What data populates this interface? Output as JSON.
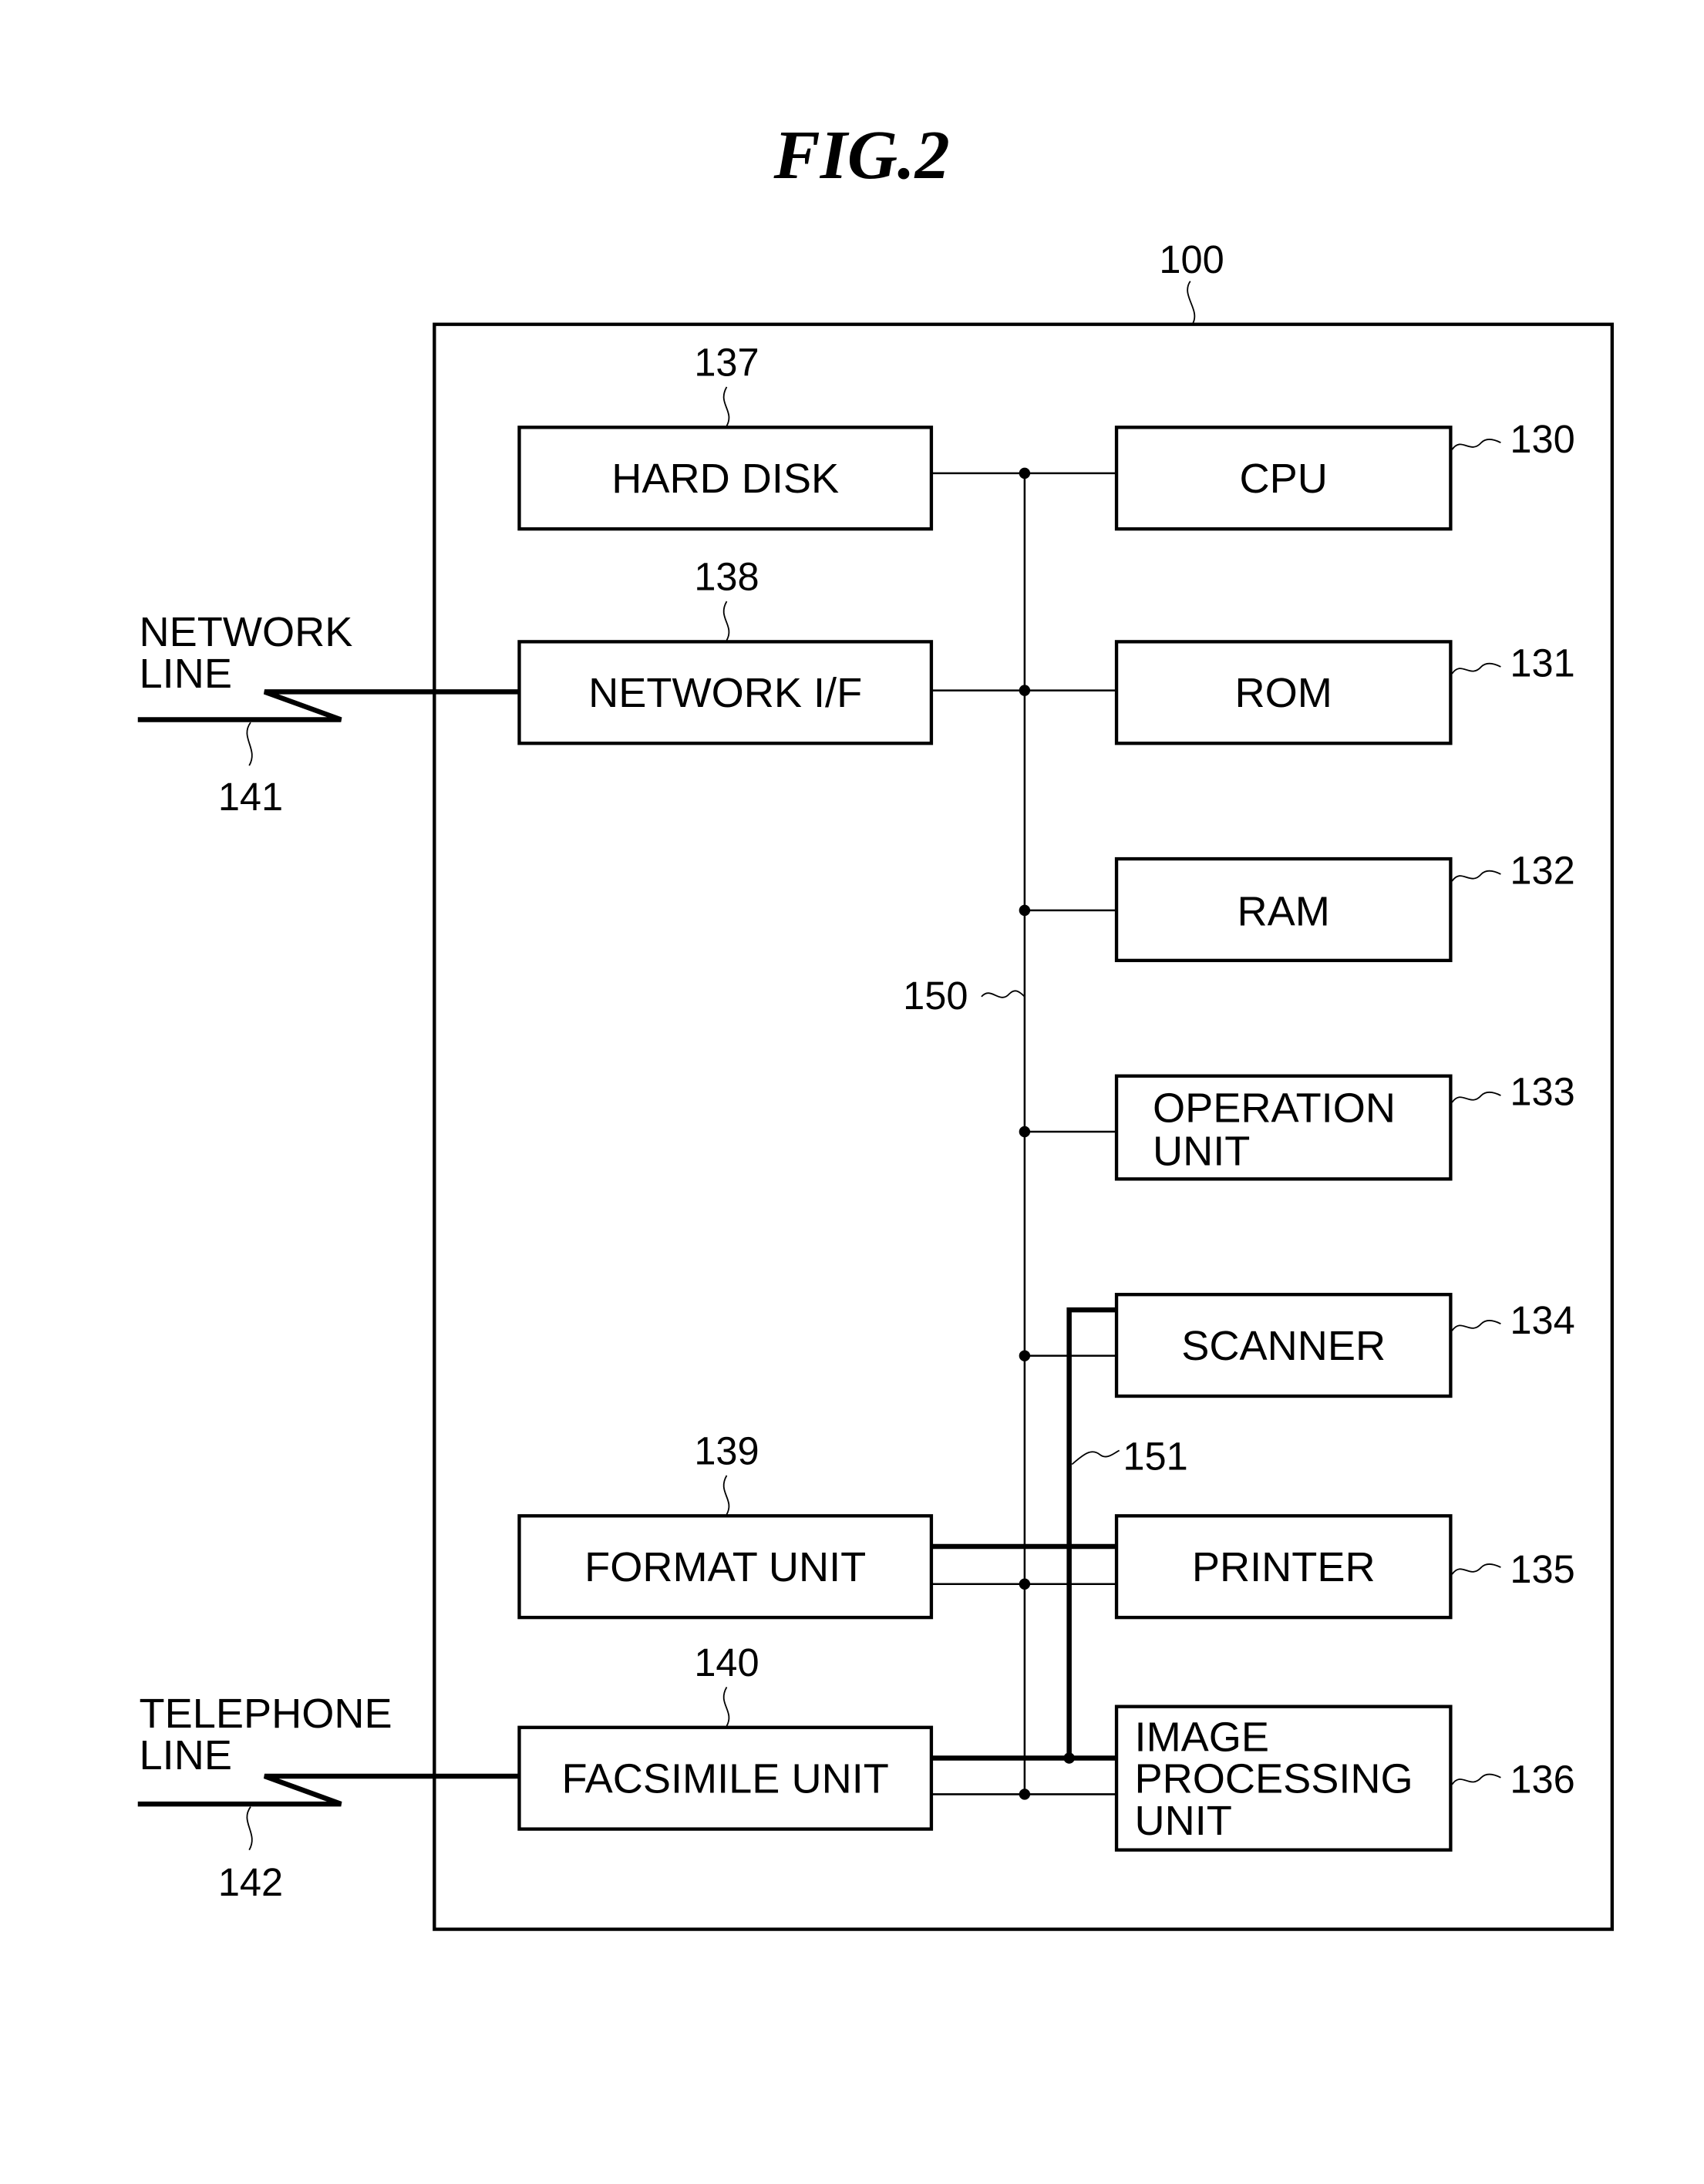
{
  "figure": {
    "title": "FIG.2",
    "apparatus_ref": "100",
    "bus_ref": "150",
    "image_bus_ref": "151"
  },
  "blocks": {
    "hard_disk": {
      "label": [
        "HARD DISK"
      ],
      "ref": "137"
    },
    "network_if": {
      "label": [
        "NETWORK I/F"
      ],
      "ref": "138"
    },
    "format_unit": {
      "label": [
        "FORMAT UNIT"
      ],
      "ref": "139"
    },
    "facsimile_unit": {
      "label": [
        "FACSIMILE UNIT"
      ],
      "ref": "140"
    },
    "cpu": {
      "label": [
        "CPU"
      ],
      "ref": "130"
    },
    "rom": {
      "label": [
        "ROM"
      ],
      "ref": "131"
    },
    "ram": {
      "label": [
        "RAM"
      ],
      "ref": "132"
    },
    "operation_unit": {
      "label": [
        "OPERATION",
        "UNIT"
      ],
      "ref": "133"
    },
    "scanner": {
      "label": [
        "SCANNER"
      ],
      "ref": "134"
    },
    "printer": {
      "label": [
        "PRINTER"
      ],
      "ref": "135"
    },
    "image_processing_unit": {
      "label": [
        "IMAGE",
        "PROCESSING",
        "UNIT"
      ],
      "ref": "136"
    }
  },
  "external": {
    "network_line": {
      "label": [
        "NETWORK",
        "LINE"
      ],
      "ref": "141"
    },
    "telephone_line": {
      "label": [
        "TELEPHONE",
        "LINE"
      ],
      "ref": "142"
    }
  }
}
